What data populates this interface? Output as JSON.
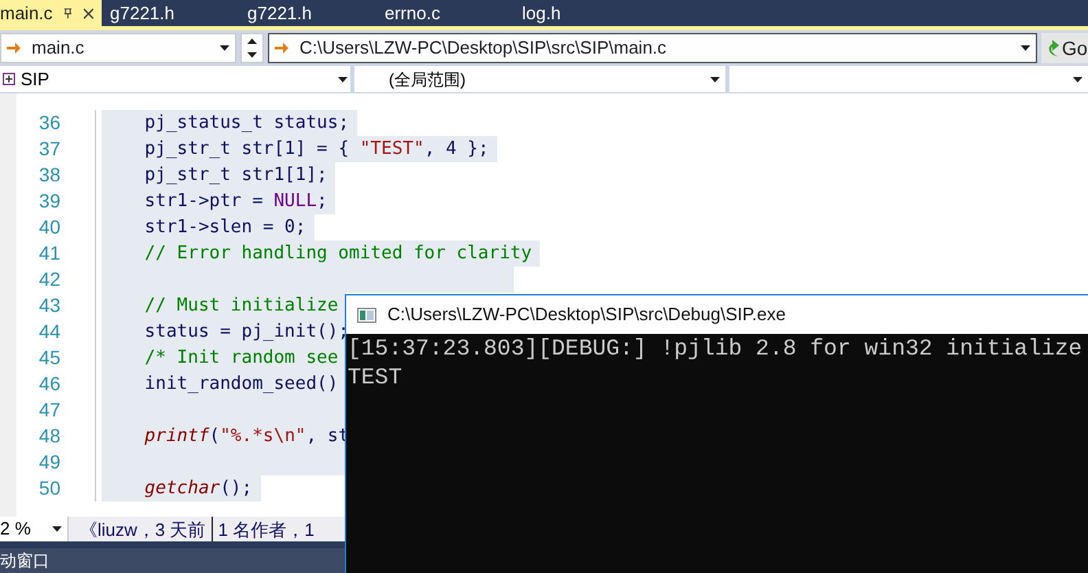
{
  "tabs": [
    {
      "label": "main.c",
      "selected": true
    },
    {
      "label": "g7221.h",
      "selected": false
    },
    {
      "label": "g7221.h",
      "selected": false
    },
    {
      "label": "errno.c",
      "selected": false
    },
    {
      "label": "log.h",
      "selected": false
    }
  ],
  "nav_bar": {
    "file_dropdown": "main.c",
    "path_dropdown": "C:\\Users\\LZW-PC\\Desktop\\SIP\\src\\SIP\\main.c",
    "go_button": "Go"
  },
  "scope_bar": {
    "project_dropdown": "SIP",
    "scope_dropdown": "(全局范围)"
  },
  "code_lines": [
    {
      "number": "36",
      "highlighted": true,
      "tokens": [
        {
          "kind": "type",
          "text": "    pj_status_t"
        },
        {
          "kind": "plain",
          "text": " status;"
        }
      ]
    },
    {
      "number": "37",
      "highlighted": true,
      "tokens": [
        {
          "kind": "type",
          "text": "    pj_str_t"
        },
        {
          "kind": "plain",
          "text": " str[1] = { "
        },
        {
          "kind": "string",
          "text": "\"TEST\""
        },
        {
          "kind": "plain",
          "text": ", 4 };"
        }
      ]
    },
    {
      "number": "38",
      "highlighted": true,
      "tokens": [
        {
          "kind": "type",
          "text": "    pj_str_t"
        },
        {
          "kind": "plain",
          "text": " str1[1];"
        }
      ]
    },
    {
      "number": "39",
      "highlighted": true,
      "tokens": [
        {
          "kind": "plain",
          "text": "    str1->ptr = "
        },
        {
          "kind": "macro",
          "text": "NULL"
        },
        {
          "kind": "plain",
          "text": ";"
        }
      ]
    },
    {
      "number": "40",
      "highlighted": true,
      "tokens": [
        {
          "kind": "plain",
          "text": "    str1->slen = 0;"
        }
      ]
    },
    {
      "number": "41",
      "highlighted": true,
      "tokens": [
        {
          "kind": "comment",
          "text": "    // Error handling omited for clarity"
        }
      ]
    },
    {
      "number": "42",
      "highlighted": true
    },
    {
      "number": "43",
      "highlighted": true,
      "tokens": [
        {
          "kind": "comment",
          "text": "    // Must initialize"
        }
      ]
    },
    {
      "number": "44",
      "highlighted": true,
      "tokens": [
        {
          "kind": "plain",
          "text": "    status = pj_init();"
        }
      ]
    },
    {
      "number": "45",
      "highlighted": true,
      "tokens": [
        {
          "kind": "comment",
          "text": "    /* Init random see"
        }
      ]
    },
    {
      "number": "46",
      "highlighted": true,
      "tokens": [
        {
          "kind": "plain",
          "text": "    init_random_seed()"
        }
      ]
    },
    {
      "number": "47",
      "highlighted": true
    },
    {
      "number": "48",
      "highlighted": true,
      "tokens": [
        {
          "kind": "function",
          "text": "    printf"
        },
        {
          "kind": "plain",
          "text": "("
        },
        {
          "kind": "string",
          "text": "\"%.*s\\n\""
        },
        {
          "kind": "plain",
          "text": ", st"
        }
      ]
    },
    {
      "number": "49",
      "highlighted": true
    },
    {
      "number": "50",
      "highlighted": true,
      "tokens": [
        {
          "kind": "function",
          "text": "    getchar"
        },
        {
          "kind": "plain",
          "text": "();"
        }
      ]
    }
  ],
  "status_bar": {
    "zoom": "2 %",
    "author_info": "《liuzw，3 天前",
    "authors": "1 名作者，1"
  },
  "bottom_panel": {
    "tab": "动窗口"
  },
  "console_window": {
    "title": "C:\\Users\\LZW-PC\\Desktop\\SIP\\src\\Debug\\SIP.exe",
    "lines": [
      "[15:37:23.803][DEBUG:] !pjlib 2.8 for win32 initialize",
      "TEST"
    ]
  }
}
